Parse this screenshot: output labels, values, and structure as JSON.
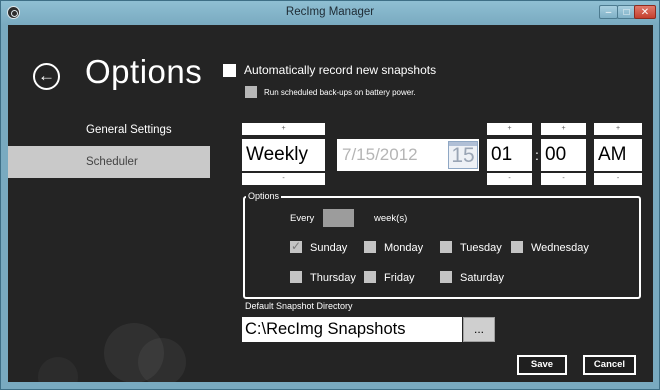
{
  "window": {
    "title": "RecImg Manager",
    "min_glyph": "–",
    "max_glyph": "□",
    "close_glyph": "✕"
  },
  "header": {
    "back_glyph": "←",
    "title": "Options"
  },
  "sidebar": {
    "items": [
      {
        "label": "General Settings",
        "selected": false
      },
      {
        "label": "Scheduler",
        "selected": true
      }
    ]
  },
  "settings": {
    "auto_record": {
      "label": "Automatically record new snapshots",
      "checked": false
    },
    "battery": {
      "label": "Run scheduled back-ups on battery power.",
      "checked": false
    }
  },
  "schedule": {
    "frequency": "Weekly",
    "date": "7/15/2012",
    "calendar_day": "15",
    "hour": "01",
    "minute": "00",
    "ampm": "AM",
    "spin_up": "+",
    "spin_down": "-",
    "time_separator": ":"
  },
  "options": {
    "legend": "Options",
    "every_label": "Every",
    "weeks_value": "",
    "weeks_label": "week(s)",
    "days": [
      {
        "label": "Sunday",
        "checked": true
      },
      {
        "label": "Monday",
        "checked": false
      },
      {
        "label": "Tuesday",
        "checked": false
      },
      {
        "label": "Wednesday",
        "checked": false
      },
      {
        "label": "Thursday",
        "checked": false
      },
      {
        "label": "Friday",
        "checked": false
      },
      {
        "label": "Saturday",
        "checked": false
      }
    ]
  },
  "directory": {
    "label": "Default Snapshot Directory",
    "value": "C:\\RecImg Snapshots",
    "browse_label": "..."
  },
  "actions": {
    "save": "Save",
    "cancel": "Cancel"
  },
  "colors": {
    "background": "#242424",
    "window_frame": "#79aac0",
    "selected_nav": "#c9c9c9",
    "text": "#ffffff"
  }
}
